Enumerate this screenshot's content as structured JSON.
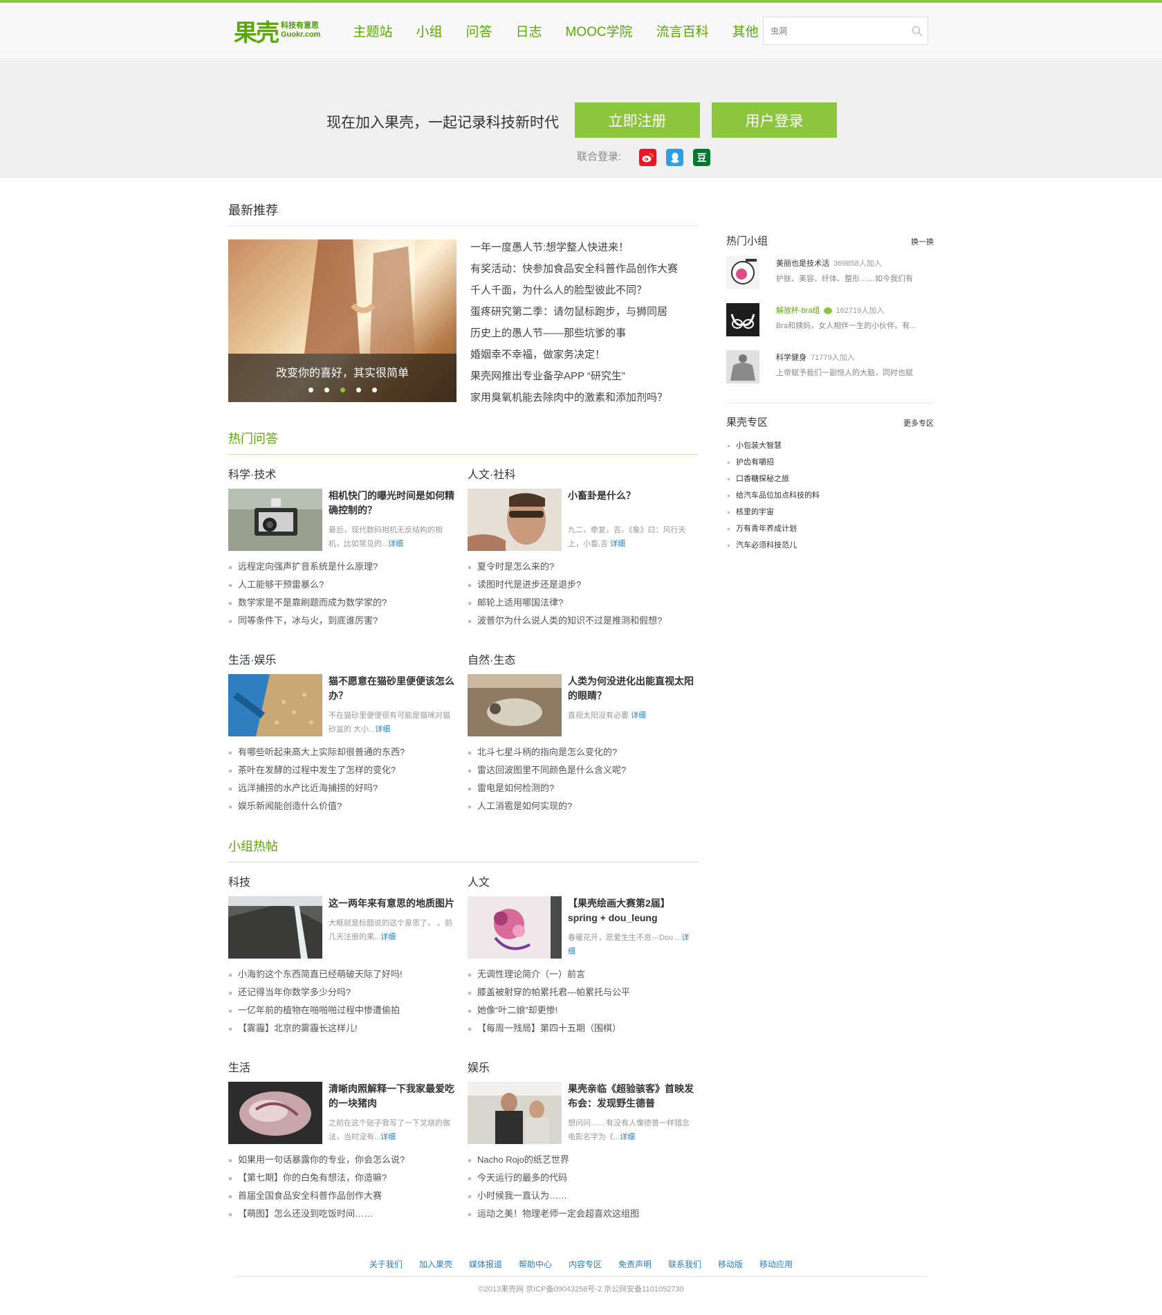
{
  "header": {
    "logo": "果壳",
    "logo_tagline": "科技有意思",
    "logo_domain": "Guokr.com",
    "nav": [
      "主题站",
      "小组",
      "问答",
      "日志",
      "MOOC学院",
      "流言百科"
    ],
    "nav_more": "其他",
    "search_placeholder": "虫洞",
    "accent_color": "#8cc63f"
  },
  "banner": {
    "slogan": "现在加入果壳，一起记录科技新时代",
    "register": "立即注册",
    "login": "用户登录",
    "social_label": "联合登录:",
    "social": [
      "weibo-icon",
      "qq-icon",
      "douban-icon"
    ],
    "douban_glyph": "豆"
  },
  "latest": {
    "title": "最新推荐",
    "slider_caption": "改变你的喜好，其实很简单",
    "slider_active_index": 2,
    "slider_count": 5,
    "items": [
      "一年一度愚人节:想学整人快进来！",
      "有奖活动：快参加食品安全科普作品创作大赛",
      "千人千面，为什么人的脸型彼此不同？",
      "蛋疼研究第二季：请勿鼠标跑步，与狮同居",
      "历史上的愚人节——那些坑爹的事",
      "婚姻幸不幸福，做家务决定！",
      "果壳网推出专业备孕APP “研究生”",
      "家用臭氧机能去除肉中的激素和添加剂吗？"
    ]
  },
  "qa": {
    "title": "热门问答",
    "blocks": [
      {
        "category": "科学·技术",
        "feature_title": "相机快门的曝光时间是如何精确控制的？",
        "feature_desc": "最后，现代数码相机无反结构的相机，比如常见的...",
        "more": "详细",
        "questions": [
          "远程定向强声扩音系统是什么原理?",
          "人工能够干预雷暴么?",
          "数学家是不是靠刷题而成为数学家的?",
          "同等条件下，冰与火，到底谁厉害?"
        ]
      },
      {
        "category": "人文·社科",
        "feature_title": "小畜卦是什么？",
        "feature_desc": "九二，牵复，吉。《象》曰：风行天上，小畜,吉 ",
        "more": "详细",
        "questions": [
          "夏令时是怎么来的?",
          "读图时代是进步还是退步?",
          "邮轮上适用哪国法律?",
          "波普尔为什么说人类的知识不过是推测和假想?"
        ]
      },
      {
        "category": "生活·娱乐",
        "feature_title": "猫不愿意在猫砂里便便该怎么办？",
        "feature_desc": "不在猫砂里便便很有可能是猫咪对猫砂盆的 大小...",
        "more": "详细",
        "questions": [
          "有哪些听起来高大上实际却很普通的东西?",
          "茶叶在发酵的过程中发生了怎样的变化?",
          "远洋捕捞的水产比近海捕捞的好吗?",
          "娱乐新闻能创造什么价值?"
        ]
      },
      {
        "category": "自然·生态",
        "feature_title": "人类为何没进化出能直视太阳的眼睛？",
        "feature_desc": "直视太阳没有必要 ",
        "more": "详细",
        "questions": [
          "北斗七星斗柄的指向是怎么变化的?",
          "雷达回波图里不同颜色是什么含义呢?",
          "雷电是如何检测的?",
          "人工消雹是如何实现的?"
        ]
      }
    ]
  },
  "groups_hot": {
    "title": "小组热帖",
    "blocks": [
      {
        "category": "科技",
        "feature_title": "这一两年来有意思的地质图片",
        "feature_desc": "大概就是标题说的这个意思了。 。前几天注册的果...",
        "more": "详细",
        "questions": [
          "小海豹这个东西简直已经萌破天际了好吗!",
          "还记得当年你数学多少分吗?",
          "一亿年前的植物在啪啪啪过程中惨遭偷拍",
          "【雾霾】北京的雾霾长这样儿!"
        ]
      },
      {
        "category": "人文",
        "feature_title": "【果壳绘画大赛第2届】spring + dou_leung",
        "feature_desc": "春暖花开，愿爱生生不息---Dou ...",
        "more": "详细",
        "questions": [
          "无调性理论简介（一）前言",
          "膝盖被射穿的帕累托君---帕累托与公平",
          "她像“叶二娘”却更惨!",
          "【每周一残局】第四十五期（围棋）"
        ]
      },
      {
        "category": "生活",
        "feature_title": "清晰肉照解释一下我家最爱吃的一块猪肉",
        "feature_desc": "之前在这个贴子我写了一下叉烧的做法，当时没有...",
        "more": "详细",
        "questions": [
          "如果用一句话暴露你的专业，你会怎么说?",
          "【第七期】你的白兔有想法，你造嘛?",
          "首届全国食品安全科普作品创作大赛",
          "【萌图】怎么还没到吃饭时间……"
        ]
      },
      {
        "category": "娱乐",
        "feature_title": "果壳亲临《超验骇客》首映发布会：发现野生德普",
        "feature_desc": "想问问……有没有人像德普一样错念电影名字为《...",
        "more": "详细",
        "questions": [
          "Nacho Rojo的纸艺世界",
          "今天运行的最多的代码",
          "小时候我一直认为……",
          "运动之美！物理老师一定会超喜欢这组图"
        ]
      }
    ]
  },
  "sidebar": {
    "hot_groups_title": "热门小组",
    "switch": "换一换",
    "groups": [
      {
        "name": "美丽也是技术活",
        "count": "369858人加入",
        "desc": "护肤、美容、纤体、整形……如今我们有"
      },
      {
        "name": "解放杯-bra组",
        "count": "162719人加入",
        "desc": "Bra和姨妈，女人相伴一生的小伙伴。有..."
      },
      {
        "name": "科学健身",
        "count": "71779人加入",
        "desc": "上帝赋予我们一副惊人的大脑，同时也赋"
      }
    ],
    "zone_title": "果壳专区",
    "zone_more": "更多专区",
    "zones": [
      "小包装大智慧",
      "护齿有嚼招",
      "口香糖探秘之旅",
      "给汽车品位加点科技的料",
      "核里的宇宙",
      "万有青年养成计划",
      "汽车必须科技范儿"
    ]
  },
  "footer": {
    "links": [
      "关于我们",
      "加入果壳",
      "媒体报道",
      "帮助中心",
      "内容专区",
      "免责声明",
      "联系我们",
      "移动版",
      "移动应用"
    ],
    "copyright": "©2013果壳网 京ICP备09043258号-2 京公网安备1101052730"
  }
}
